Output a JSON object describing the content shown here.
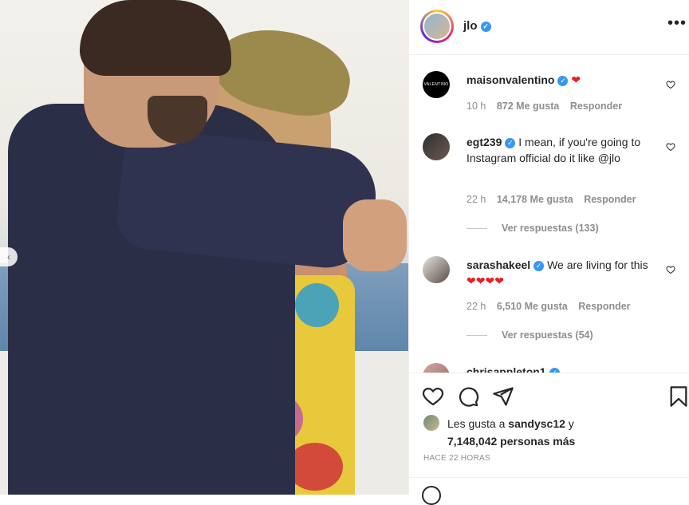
{
  "post": {
    "username": "jlo",
    "verified_icon": "verified-badge-icon",
    "more_icon": "more-options-icon"
  },
  "comments": [
    {
      "user": "maisonvalentino",
      "avatar_text": "VALENTINO",
      "text": "",
      "emoji": "❤",
      "time": "10 h",
      "likes": "872 Me gusta",
      "reply": "Responder"
    },
    {
      "user": "egt239",
      "text": "I mean, if you're going to Instagram official do it like @jlo",
      "time": "22 h",
      "likes": "14,178 Me gusta",
      "reply": "Responder",
      "replies": "Ver respuestas (133)"
    },
    {
      "user": "sarashakeel",
      "text": "We are living for this",
      "emoji": "❤❤❤❤",
      "time": "22 h",
      "likes": "6,510 Me gusta",
      "reply": "Responder",
      "replies": "Ver respuestas (54)"
    },
    {
      "user": "chrisappleton1"
    }
  ],
  "actions": {
    "like_icon": "heart-icon",
    "comment_icon": "comment-icon",
    "share_icon": "share-icon",
    "save_icon": "bookmark-icon"
  },
  "likes": {
    "prefix": "Les gusta a",
    "user": "sandysc12",
    "suffix_1": "y",
    "count": "7,148,042 personas más"
  },
  "timestamp": "HACE 22 HORAS",
  "colors": {
    "verified": "#3897f0",
    "heart": "#ed1c24",
    "text": "#262626",
    "muted": "#8e8e8e"
  }
}
